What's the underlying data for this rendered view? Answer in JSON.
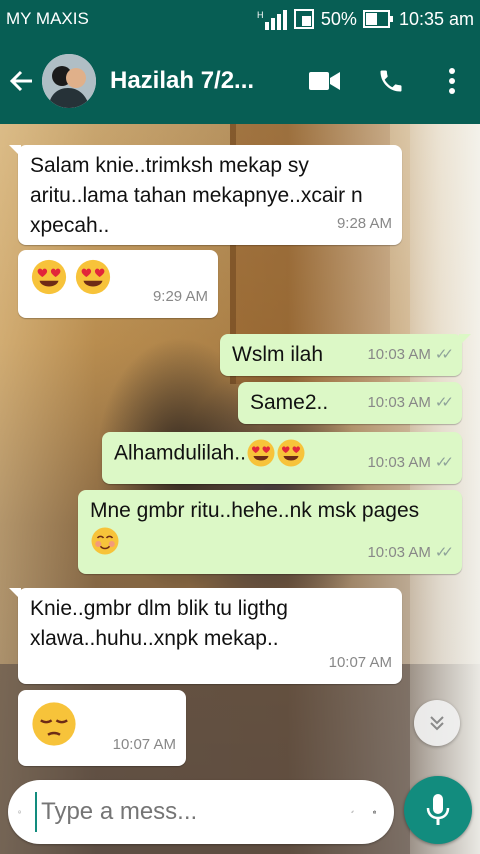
{
  "status_bar": {
    "carrier": "MY MAXIS",
    "battery": "50%",
    "time": "10:35 am"
  },
  "header": {
    "contact_name": "Hazilah 7/2..."
  },
  "messages": [
    {
      "dir": "in",
      "text": "Salam knie..trimksh mekap sy aritu..lama tahan mekapnye..xcair n xpecah..",
      "time": "9:28 AM"
    },
    {
      "dir": "in",
      "text": "",
      "emoji": [
        "heart-eyes",
        "heart-eyes"
      ],
      "time": "9:29 AM"
    },
    {
      "dir": "out",
      "text": "Wslm ilah",
      "time": "10:03 AM"
    },
    {
      "dir": "out",
      "text": "Same2..",
      "time": "10:03 AM"
    },
    {
      "dir": "out",
      "text": "Alhamdulilah..",
      "emoji": [
        "heart-eyes",
        "heart-eyes"
      ],
      "time": "10:03 AM"
    },
    {
      "dir": "out",
      "text": "Mne gmbr ritu..hehe..nk msk pages",
      "emoji": [
        "smiling-blush"
      ],
      "time": "10:03 AM"
    },
    {
      "dir": "in",
      "text": "Knie..gmbr dlm blik tu ligthg xlawa..huhu..xnpk mekap..",
      "time": "10:07 AM"
    },
    {
      "dir": "in",
      "text": "",
      "emoji": [
        "pensive"
      ],
      "time": "10:07 AM"
    }
  ],
  "composer": {
    "placeholder": "Type a mess..."
  },
  "colors": {
    "header": "#075e54",
    "outgoing_bubble": "#dcf8c6",
    "incoming_bubble": "#ffffff",
    "fab": "#128c7e"
  }
}
